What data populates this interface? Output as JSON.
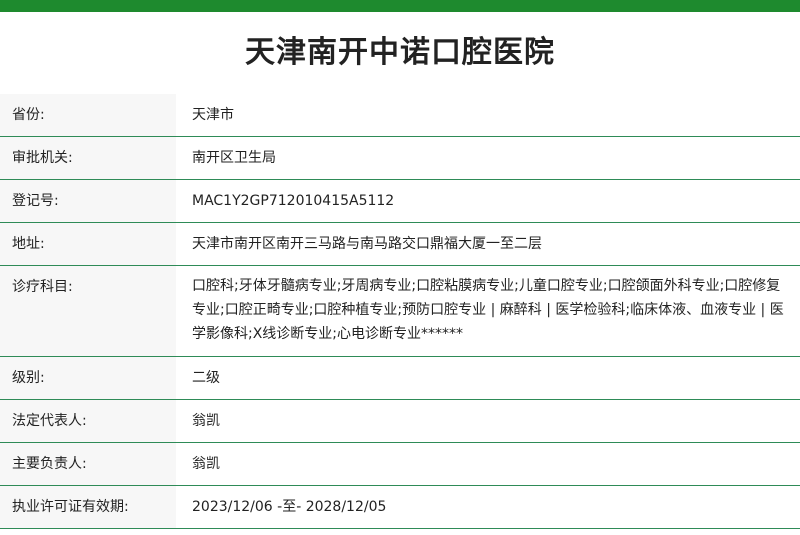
{
  "page": {
    "title": "天津南开中诺口腔医院"
  },
  "rows": [
    {
      "label": "省份:",
      "value": "天津市"
    },
    {
      "label": "审批机关:",
      "value": "南开区卫生局"
    },
    {
      "label": "登记号:",
      "value": "MAC1Y2GP712010415A5112"
    },
    {
      "label": "地址:",
      "value": "天津市南开区南开三马路与南马路交口鼎福大厦一至二层"
    },
    {
      "label": "诊疗科目:",
      "value": "口腔科;牙体牙髓病专业;牙周病专业;口腔粘膜病专业;儿童口腔专业;口腔颌面外科专业;口腔修复专业;口腔正畸专业;口腔种植专业;预防口腔专业 | 麻醉科 | 医学检验科;临床体液、血液专业 | 医学影像科;X线诊断专业;心电诊断专业******"
    },
    {
      "label": "级别:",
      "value": "二级"
    },
    {
      "label": "法定代表人:",
      "value": "翁凯"
    },
    {
      "label": "主要负责人:",
      "value": "翁凯"
    },
    {
      "label": "执业许可证有效期:",
      "value": "2023/12/06 -至- 2028/12/05"
    }
  ],
  "colors": {
    "accent": "#1e8a2e",
    "row_border": "#2e8b57",
    "label_bg": "#f7f7f7"
  }
}
